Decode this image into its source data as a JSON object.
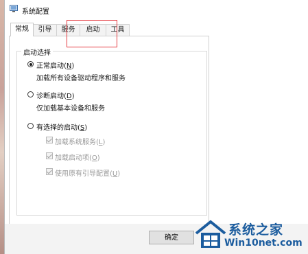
{
  "window": {
    "title": "系统配置"
  },
  "tabs": [
    {
      "label": "常规",
      "active": true
    },
    {
      "label": "引导",
      "active": false
    },
    {
      "label": "服务",
      "active": false
    },
    {
      "label": "启动",
      "active": false
    },
    {
      "label": "工具",
      "active": false
    }
  ],
  "startup_selection": {
    "group_title": "启动选择",
    "normal": {
      "label_main": "正常启动(",
      "label_key": "N",
      "label_end": ")",
      "description": "加载所有设备驱动程序和服务",
      "selected": true
    },
    "diagnostic": {
      "label_main": "诊断启动(",
      "label_key": "D",
      "label_end": ")",
      "description": "仅加载基本设备和服务",
      "selected": false
    },
    "selective": {
      "label_main": "有选择的启动(",
      "label_key": "S",
      "label_end": ")",
      "selected": false,
      "options": [
        {
          "label_main": "加载系统服务(",
          "label_key": "L",
          "label_end": ")",
          "checked": true,
          "enabled": false
        },
        {
          "label_main": "加载启动项(",
          "label_key": "O",
          "label_end": ")",
          "checked": true,
          "enabled": false
        },
        {
          "label_main": "使用原有引导配置(",
          "label_key": "U",
          "label_end": ")",
          "checked": true,
          "enabled": false
        }
      ]
    }
  },
  "buttons": {
    "ok": "确定"
  },
  "watermark": {
    "brand": "系统之家",
    "url": "Win10net.com"
  },
  "colors": {
    "highlight": "#e5393f",
    "brand": "#1b5c9e"
  }
}
